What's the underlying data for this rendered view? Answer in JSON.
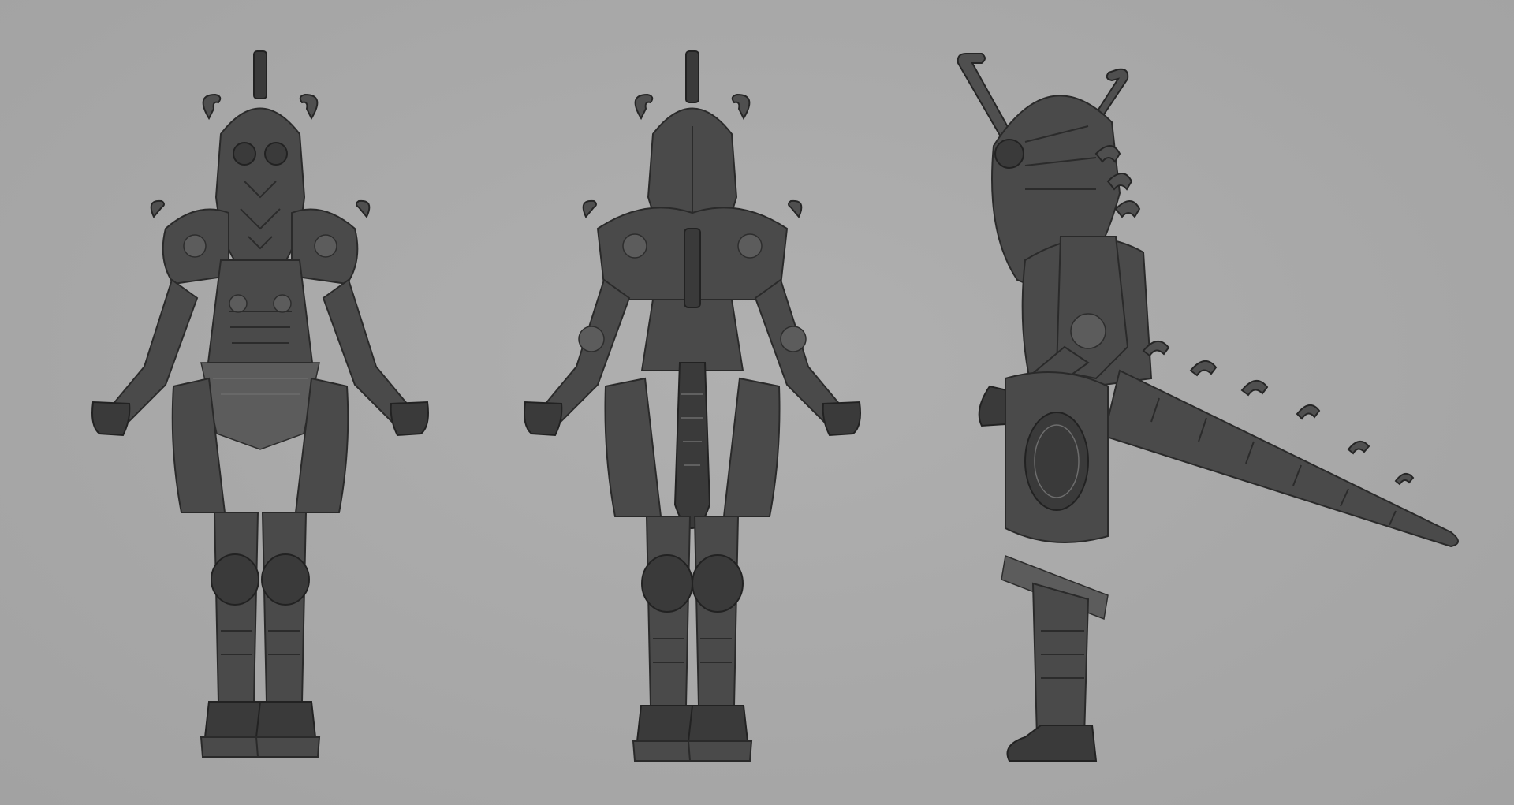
{
  "scene": {
    "background_color": "#aaaaaa",
    "model_color": "#4a4a4a",
    "views": [
      {
        "name": "front",
        "icon": "armored-figure-front"
      },
      {
        "name": "back",
        "icon": "armored-figure-back"
      },
      {
        "name": "side",
        "icon": "armored-figure-side-with-tail"
      }
    ]
  }
}
